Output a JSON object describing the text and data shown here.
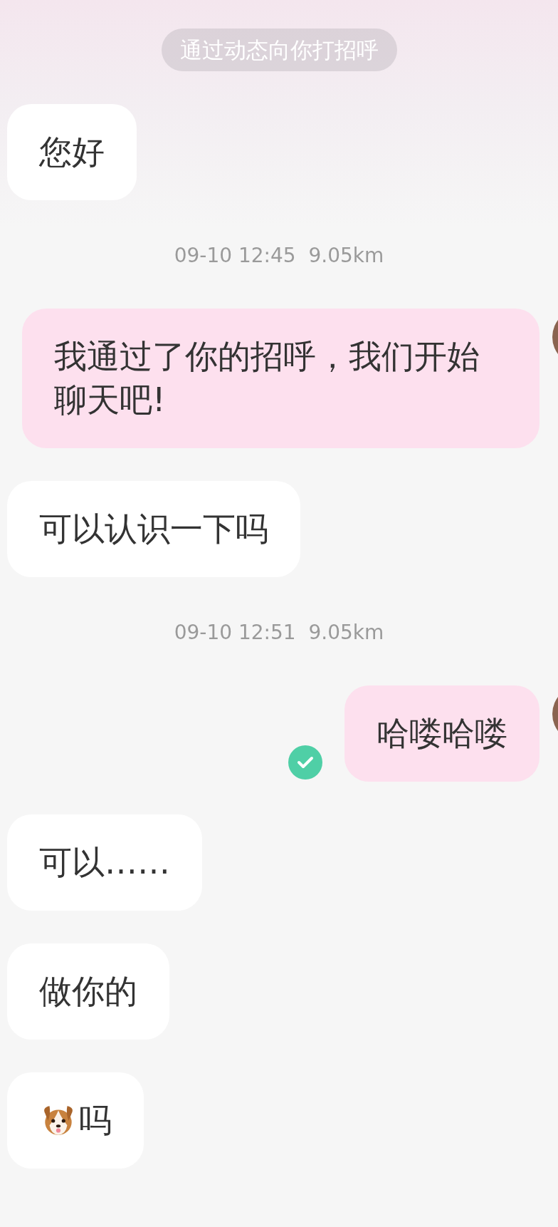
{
  "messages": [
    {
      "kind": "system",
      "text": "通过动态向你打招呼"
    },
    {
      "kind": "in",
      "text": "您好"
    },
    {
      "kind": "time",
      "text": "09-10 12:45  9.05km"
    },
    {
      "kind": "out",
      "text": "我通过了你的招呼，我们开始聊天吧!",
      "delivered": false
    },
    {
      "kind": "in",
      "text": "可以认识一下吗"
    },
    {
      "kind": "time",
      "text": "09-10 12:51  9.05km"
    },
    {
      "kind": "out",
      "text": "哈喽哈喽",
      "delivered": true
    },
    {
      "kind": "in",
      "text": "可以……"
    },
    {
      "kind": "in",
      "text": "做你的"
    },
    {
      "kind": "dog",
      "text": "吗"
    }
  ]
}
